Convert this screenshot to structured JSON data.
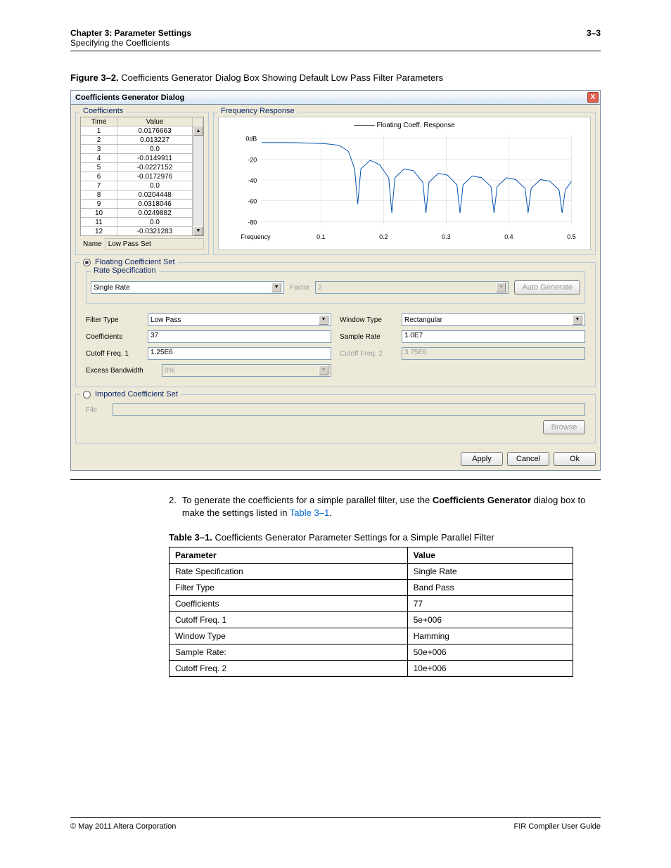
{
  "header": {
    "chapter": "Chapter 3:  Parameter Settings",
    "section": "Specifying the Coefficients",
    "pagenum": "3–3"
  },
  "figure_caption_label": "Figure 3–2.",
  "figure_caption_text": "Coefficients Generator Dialog Box Showing Default Low Pass Filter Parameters",
  "dialog": {
    "title": "Coefficients Generator Dialog",
    "close_x": "X",
    "coefficients_group": "Coefficients",
    "freq_group": "Frequency Response",
    "table": {
      "time_header": "Time",
      "value_header": "Value",
      "rows": [
        {
          "t": "1",
          "v": "0.0176663"
        },
        {
          "t": "2",
          "v": "0.013227"
        },
        {
          "t": "3",
          "v": "0.0"
        },
        {
          "t": "4",
          "v": "-0.0149911"
        },
        {
          "t": "5",
          "v": "-0.0227152"
        },
        {
          "t": "6",
          "v": "-0.0172976"
        },
        {
          "t": "7",
          "v": "0.0"
        },
        {
          "t": "8",
          "v": "0.0204448"
        },
        {
          "t": "9",
          "v": "0.0318046"
        },
        {
          "t": "10",
          "v": "0.0249882"
        },
        {
          "t": "11",
          "v": "0.0"
        },
        {
          "t": "12",
          "v": "-0.0321283"
        }
      ],
      "name_label": "Name",
      "name_value": "Low Pass Set"
    },
    "chart": {
      "legend": "Floating Coeff. Response",
      "xlabel": "Frequency",
      "yticks": [
        "0dB",
        "-20",
        "-40",
        "-60",
        "-80"
      ],
      "xticks": [
        "0.1",
        "0.2",
        "0.3",
        "0.4",
        "0.5"
      ]
    },
    "floating_radio": "Floating Coefficient Set",
    "imported_radio": "Imported Coefficient Set",
    "rate_spec_label": "Rate Specification",
    "rate_select": "Single Rate",
    "factor_label": "Factor",
    "factor_value": "2",
    "auto_generate": "Auto Generate",
    "filter_type_label": "Filter Type",
    "filter_type_value": "Low Pass",
    "window_type_label": "Window Type",
    "window_type_value": "Rectangular",
    "coefficients_label": "Coefficients",
    "coefficients_value": "37",
    "sample_rate_label": "Sample Rate",
    "sample_rate_value": "1.0E7",
    "cutoff1_label": "Cutoff Freq. 1",
    "cutoff1_value": "1.25E6",
    "cutoff2_label": "Cutoff Freq. 2",
    "cutoff2_value": "3.75E6",
    "excess_bw_label": "Excess Bandwidth",
    "excess_bw_value": "0%",
    "file_label": "File",
    "browse": "Browse",
    "apply": "Apply",
    "cancel": "Cancel",
    "ok": "Ok"
  },
  "body": {
    "step_num": "2.",
    "step_text_1": "To generate the coefficients for a simple parallel filter, use the ",
    "step_bold": "Coefficients Generator",
    "step_text_2": " dialog box to make the settings listed in ",
    "step_link": "Table 3–1",
    "step_text_3": "."
  },
  "table_caption_label": "Table 3–1.",
  "table_caption_text": "Coefficients Generator Parameter Settings for a Simple Parallel Filter",
  "param_table": {
    "h1": "Parameter",
    "h2": "Value",
    "rows": [
      {
        "p": "Rate Specification",
        "v": "Single Rate"
      },
      {
        "p": "Filter Type",
        "v": "Band Pass"
      },
      {
        "p": "Coefficients",
        "v": "77"
      },
      {
        "p": "Cutoff Freq. 1",
        "v": "5e+006"
      },
      {
        "p": "Window Type",
        "v": "Hamming"
      },
      {
        "p": "Sample Rate:",
        "v": "50e+006"
      },
      {
        "p": "Cutoff Freq. 2",
        "v": "10e+006"
      }
    ]
  },
  "footer": {
    "left": "© May 2011   Altera Corporation",
    "right": "FIR Compiler User Guide"
  },
  "chart_data": {
    "type": "line",
    "title": "Floating Coeff. Response",
    "xlabel": "Frequency",
    "ylabel": "dB",
    "xlim": [
      0,
      0.5
    ],
    "ylim": [
      -90,
      5
    ],
    "series": [
      {
        "name": "Floating Coeff. Response",
        "x": [
          0,
          0.05,
          0.1,
          0.125,
          0.14,
          0.15,
          0.155,
          0.16,
          0.175,
          0.19,
          0.205,
          0.21,
          0.215,
          0.23,
          0.245,
          0.26,
          0.265,
          0.27,
          0.285,
          0.3,
          0.315,
          0.32,
          0.325,
          0.34,
          0.355,
          0.37,
          0.375,
          0.38,
          0.395,
          0.41,
          0.425,
          0.43,
          0.435,
          0.45,
          0.465,
          0.48,
          0.485,
          0.49,
          0.5
        ],
        "y": [
          0,
          0,
          -1,
          -3,
          -10,
          -30,
          -70,
          -30,
          -20,
          -25,
          -40,
          -80,
          -40,
          -30,
          -32,
          -45,
          -80,
          -45,
          -35,
          -37,
          -48,
          -80,
          -48,
          -38,
          -40,
          -50,
          -80,
          -50,
          -40,
          -42,
          -52,
          -80,
          -52,
          -42,
          -44,
          -54,
          -80,
          -54,
          -44
        ]
      }
    ]
  }
}
